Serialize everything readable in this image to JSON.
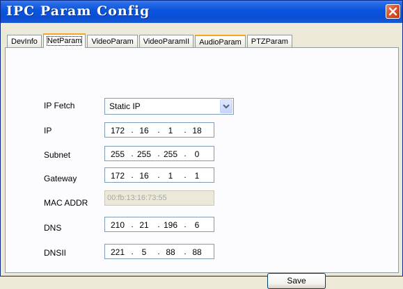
{
  "window": {
    "title": "IPC Param Config"
  },
  "tabs": [
    {
      "label": "DevInfo"
    },
    {
      "label": "NetParam"
    },
    {
      "label": "VideoParam"
    },
    {
      "label": "VideoParamII"
    },
    {
      "label": "AudioParam"
    },
    {
      "label": "PTZParam"
    }
  ],
  "active_tab": "NetParam",
  "form": {
    "ip_fetch": {
      "label": "IP Fetch",
      "value": "Static IP"
    },
    "ip": {
      "label": "IP",
      "octets": [
        "172",
        "16",
        "1",
        "18"
      ]
    },
    "subnet": {
      "label": "Subnet",
      "octets": [
        "255",
        "255",
        "255",
        "0"
      ]
    },
    "gateway": {
      "label": "Gateway",
      "octets": [
        "172",
        "16",
        "1",
        "1"
      ]
    },
    "mac": {
      "label": "MAC ADDR",
      "value": "00:fb:13:16:73:55"
    },
    "dns": {
      "label": "DNS",
      "octets": [
        "210",
        "21",
        "196",
        "6"
      ]
    },
    "dns2": {
      "label": "DNSII",
      "octets": [
        "221",
        "5",
        "88",
        "88"
      ]
    }
  },
  "buttons": {
    "save": "Save"
  },
  "icons": {
    "close": "close-icon",
    "dropdown": "chevron-down-icon"
  },
  "colors": {
    "titlebar": "#0855dd",
    "close_button": "#d8542f",
    "tab_highlight": "#f5a623"
  }
}
